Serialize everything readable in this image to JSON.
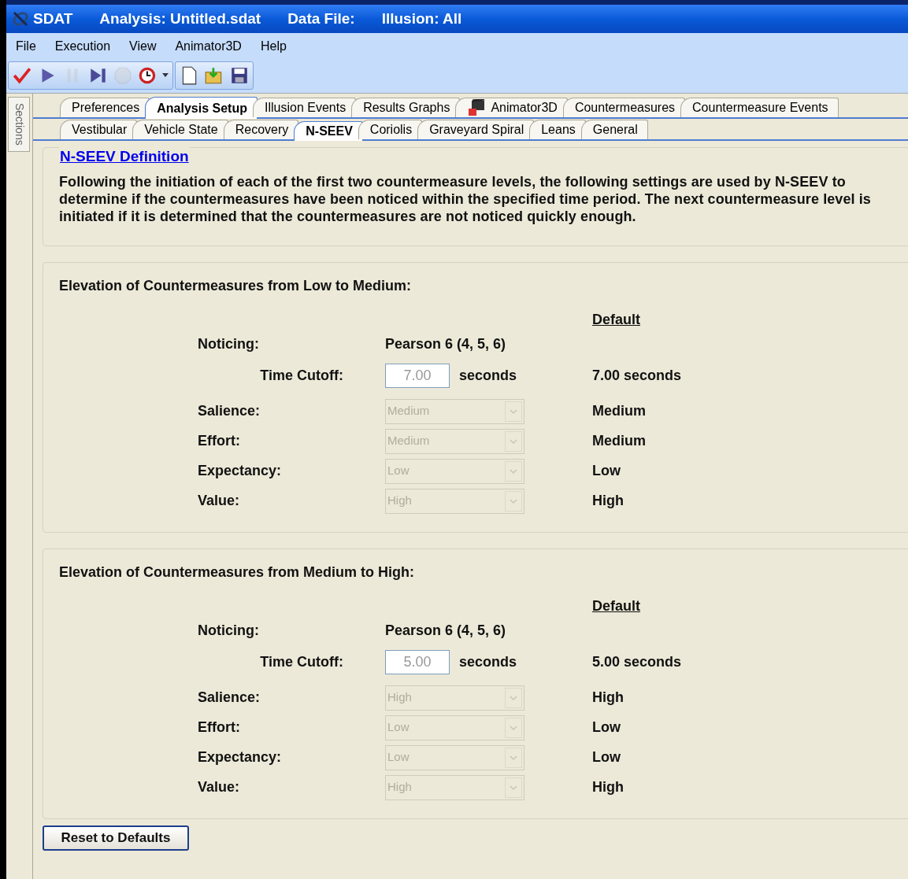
{
  "window": {
    "title_parts": [
      "SDAT",
      "Analysis: Untitled.sdat",
      "Data File:",
      "Illusion: All"
    ]
  },
  "menu": [
    "File",
    "Execution",
    "View",
    "Animator3D",
    "Help"
  ],
  "toolbar": [
    {
      "kind": "check",
      "disabled": false
    },
    {
      "kind": "play",
      "disabled": false
    },
    {
      "kind": "pause",
      "disabled": true
    },
    {
      "kind": "step",
      "disabled": false
    },
    {
      "kind": "stop",
      "disabled": true
    },
    {
      "kind": "clock",
      "disabled": false
    },
    {
      "kind": "separator"
    },
    {
      "kind": "new",
      "disabled": false
    },
    {
      "kind": "open",
      "disabled": false
    },
    {
      "kind": "save",
      "disabled": false
    }
  ],
  "sidebar": {
    "label": "Sections"
  },
  "tabs": [
    {
      "label": "Preferences",
      "selected": false
    },
    {
      "label": "Analysis Setup",
      "selected": true
    },
    {
      "label": "Illusion Events",
      "selected": false
    },
    {
      "label": "Results Graphs",
      "selected": false
    },
    {
      "label": "Animator3D",
      "selected": false,
      "icon": true
    },
    {
      "label": "Countermeasures",
      "selected": false
    },
    {
      "label": "Countermeasure Events",
      "selected": false
    }
  ],
  "subtabs": [
    {
      "label": "Vestibular",
      "selected": false
    },
    {
      "label": "Vehicle State",
      "selected": false
    },
    {
      "label": "Recovery",
      "selected": false
    },
    {
      "label": "N-SEEV",
      "selected": true
    },
    {
      "label": "Coriolis",
      "selected": false
    },
    {
      "label": "Graveyard Spiral",
      "selected": false
    },
    {
      "label": "Leans",
      "selected": false
    },
    {
      "label": "General",
      "selected": false
    }
  ],
  "definition": {
    "link": "N-SEEV Definition",
    "text": "Following the initiation of each of the first two countermeasure levels, the following settings are used by N-SEEV to determine if the countermeasures have been noticed within the specified time period.  The next countermeasure level is initiated if it is determined that the countermeasures are not noticed quickly enough."
  },
  "sections": [
    {
      "title": "Elevation of Countermeasures from Low to Medium:",
      "default_header": "Default",
      "rows": [
        {
          "kind": "text",
          "label": "Noticing:",
          "value": "Pearson 6 (4, 5, 6)"
        },
        {
          "kind": "input",
          "label": "Time Cutoff:",
          "value": "7.00",
          "unit": "seconds",
          "default": "7.00 seconds"
        },
        {
          "kind": "select",
          "label": "Salience:",
          "value": "Medium",
          "disabled": true,
          "default": "Medium"
        },
        {
          "kind": "select",
          "label": "Effort:",
          "value": "Medium",
          "disabled": true,
          "default": "Medium"
        },
        {
          "kind": "select",
          "label": "Expectancy:",
          "value": "Low",
          "disabled": true,
          "default": "Low"
        },
        {
          "kind": "select",
          "label": "Value:",
          "value": "High",
          "disabled": true,
          "default": "High"
        }
      ]
    },
    {
      "title": "Elevation of Countermeasures from Medium to High:",
      "default_header": "Default",
      "rows": [
        {
          "kind": "text",
          "label": "Noticing:",
          "value": "Pearson 6 (4, 5, 6)"
        },
        {
          "kind": "input",
          "label": "Time Cutoff:",
          "value": "5.00",
          "unit": "seconds",
          "default": "5.00 seconds"
        },
        {
          "kind": "select",
          "label": "Salience:",
          "value": "High",
          "disabled": true,
          "default": "High"
        },
        {
          "kind": "select",
          "label": "Effort:",
          "value": "Low",
          "disabled": true,
          "default": "Low"
        },
        {
          "kind": "select",
          "label": "Expectancy:",
          "value": "Low",
          "disabled": true,
          "default": "Low"
        },
        {
          "kind": "select",
          "label": "Value:",
          "value": "High",
          "disabled": true,
          "default": "High"
        }
      ]
    }
  ],
  "buttons": [
    "Reset to Defaults"
  ]
}
